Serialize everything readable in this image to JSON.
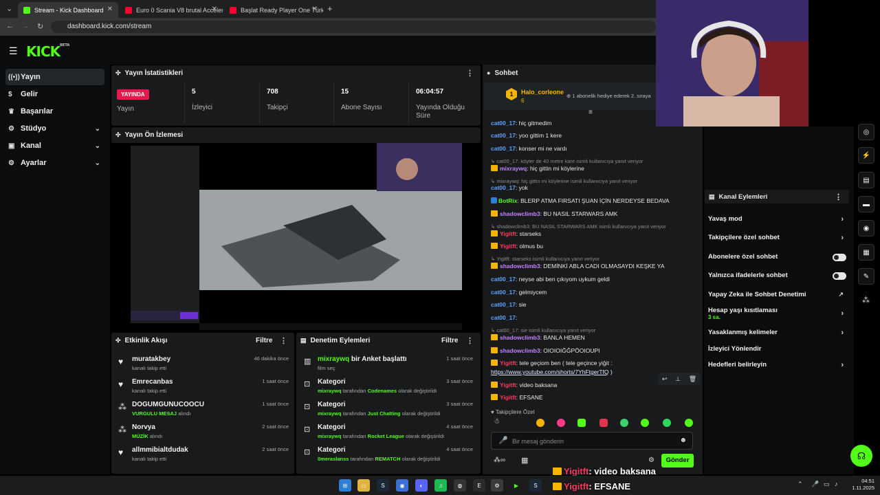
{
  "browser": {
    "tabs": [
      {
        "label": "Stream - Kick Dashboard",
        "color": "#53fc18"
      },
      {
        "label": "Euro 0 Scania V8 brutal Acceler",
        "color": "#ff0033"
      },
      {
        "label": "Başlat Ready Player One Türkçe",
        "color": "#ff0033"
      }
    ],
    "url": "dashboard.kick.com/stream"
  },
  "logo": {
    "text": "KICK",
    "sup": "BETA"
  },
  "sidebar": {
    "items": [
      {
        "label": "Yayın",
        "icon": "broadcast-icon"
      },
      {
        "label": "Gelir",
        "icon": "dollar-icon"
      },
      {
        "label": "Başarılar",
        "icon": "trophy-icon"
      },
      {
        "label": "Stüdyo",
        "icon": "gear-icon"
      },
      {
        "label": "Kanal",
        "icon": "channel-icon"
      },
      {
        "label": "Ayarlar",
        "icon": "settings-icon"
      }
    ]
  },
  "stats": {
    "title": "Yayın İstatistikleri",
    "live_badge": "YAYINDA",
    "cols": [
      {
        "value": "",
        "label": "Yayın"
      },
      {
        "value": "5",
        "label": "İzleyici"
      },
      {
        "value": "708",
        "label": "Takipçi"
      },
      {
        "value": "15",
        "label": "Abone Sayısı"
      },
      {
        "value": "06:04:57",
        "label": "Yayında Olduğu Süre"
      }
    ]
  },
  "preview": {
    "title": "Yayın Ön İzlemesi"
  },
  "activity": {
    "title": "Etkinlik Akışı",
    "filter": "Filtre",
    "rows": [
      {
        "name": "muratakbey",
        "sub": "kanalı takip etti",
        "time": "46 dakika önce"
      },
      {
        "name": "Emrecanbas",
        "sub": "kanalı takip etti",
        "time": "1 saat önce"
      },
      {
        "name": "DOGUMGUNUCOOCU",
        "sub_hl": "VURGULU MESAJ",
        "sub": "alındı",
        "time": "1 saat önce"
      },
      {
        "name": "Norvya",
        "sub_hl": "MÜZİK",
        "sub": "alındı",
        "time": "2 saat önce"
      },
      {
        "name": "allmmibialtdudak",
        "sub": "kanalı takip etti",
        "time": "2 saat önce"
      }
    ]
  },
  "moderation": {
    "title": "Denetim Eylemleri",
    "filter": "Filtre",
    "rows": [
      {
        "user": "mixraywq",
        "title": "bir Anket başlattı",
        "sub": "film seç",
        "time": "1 saat önce"
      },
      {
        "title": "Kategori",
        "user": "mixraywq",
        "mid": "tarafından",
        "cat": "Codenames",
        "end": "olarak değiştirildi",
        "time": "3 saat önce"
      },
      {
        "title": "Kategori",
        "user": "mixraywq",
        "mid": "tarafından",
        "cat": "Just Chatting",
        "end": "olarak değiştirildi",
        "time": "3 saat önce"
      },
      {
        "title": "Kategori",
        "user": "mixraywq",
        "mid": "tarafından",
        "cat": "Rocket League",
        "end": "olarak değiştirildi",
        "time": "4 saat önce"
      },
      {
        "title": "Kategori",
        "user": "0meraslanss",
        "mid": "tarafından",
        "cat": "REMATCH",
        "end": "olarak değiştirildi",
        "time": "4 saat önce"
      }
    ]
  },
  "chat": {
    "title": "Sohbet",
    "pinned_user": "Halo_corleone",
    "pinned_count": "6",
    "pinned_text": "1 abonelik hediye ederek 2. sıraya",
    "messages": [
      {
        "user": "cat00_17",
        "text": ": hiç gitmedim",
        "cls": "u-blue"
      },
      {
        "user": "cat00_17",
        "text": ": yoo gittim 1 kere",
        "cls": "u-blue"
      },
      {
        "user": "cat00_17",
        "text": ": konser mi ne vardı",
        "cls": "u-blue"
      },
      {
        "reply": "cat00_17: köyler de 40 metre kare isimli kullanıcıya yanıt veriyor"
      },
      {
        "user": "mixraywq",
        "text": ": hiç gittin mi köylerine",
        "cls": "u-purple"
      },
      {
        "reply": "mixraywq: hiç gittin mi köylerine isimli kullanıcıya yanıt veriyor"
      },
      {
        "user": "cat00_17",
        "text": ": yok",
        "cls": "u-blue"
      },
      {
        "user": "BotRix",
        "text": ": BLERP ATMA FIRSATI ŞUAN İÇİN NERDEYSE BEDAVA",
        "cls": "u-green"
      },
      {
        "user": "shadowclimb3",
        "text": ": BU NASIL STARWARS AMK",
        "cls": "u-purple"
      },
      {
        "reply": "shadowclimb3: BU NASIL STARWARS AMK isimli kullanıcıya yanıt veriyor"
      },
      {
        "user": "Yigitft",
        "text": ": starseks",
        "cls": "u-red"
      },
      {
        "user": "Yigitft",
        "text": ": olmus bu",
        "cls": "u-red"
      },
      {
        "reply": "Yigitft: starseks isimli kullanıcıya yanıt veriyor"
      },
      {
        "user": "shadowclimb3",
        "text": ": DEMİNKİ ABLA CADI OLMASAYDI KEŞKE YA",
        "cls": "u-purple"
      },
      {
        "user": "cat00_17",
        "text": ": neyse abi ben çıkıyom uykum geldi",
        "cls": "u-blue"
      },
      {
        "user": "cat00_17",
        "text": ": gelmiycem",
        "cls": "u-blue"
      },
      {
        "user": "cat00_17",
        "text": ": sie",
        "cls": "u-blue"
      },
      {
        "user": "cat00_17",
        "text": ":",
        "cls": "u-blue"
      },
      {
        "reply": "cat00_17: sie isimli kullanıcıya yanıt veriyor"
      },
      {
        "user": "shadowclimb3",
        "text": ": BANLA HEMEN",
        "cls": "u-purple"
      },
      {
        "user": "shadowclimb3",
        "text": ": OIOIOIĞĞPÖOIOUPI",
        "cls": "u-purple"
      },
      {
        "user": "Yigitft",
        "text": ": tele geçiom ben ( tele geçince yiğit :",
        "cls": "u-red"
      },
      {
        "link": "https://www.youtube.com/shorts/7YhFtgerTfQ",
        "tail": " )"
      },
      {
        "user": "Yigitft",
        "text": ": video baksana",
        "cls": "u-red"
      },
      {
        "user": "Yigitft",
        "text": ": EFSANE",
        "cls": "u-red"
      }
    ],
    "followers_only": "Takipçilere Özel",
    "input_placeholder": "Bir mesaj gönderin",
    "send_label": "Gönder"
  },
  "channel_actions": {
    "title": "Kanal Eylemleri",
    "items": [
      {
        "label": "Yavaş mod",
        "kind": "chevron"
      },
      {
        "label": "Takipçilere özel sohbet",
        "kind": "chevron"
      },
      {
        "label": "Abonelere özel sohbet",
        "kind": "toggle"
      },
      {
        "label": "Yalnızca ifadelerle sohbet",
        "kind": "toggle"
      },
      {
        "label": "Yapay Zeka ile Sohbet Denetimi",
        "kind": "ext"
      },
      {
        "label": "Hesap yaşı kısıtlaması",
        "sub": "3 sa.",
        "kind": "chevron"
      },
      {
        "label": "Yasaklanmış kelimeler",
        "kind": "chevron"
      },
      {
        "label": "İzleyici Yönlendir",
        "kind": "none"
      },
      {
        "label": "Hedefleri belirleyin",
        "kind": "chevron"
      }
    ]
  },
  "overlay": {
    "line1_user": "Yigitft",
    "line1_text": ": video baksana",
    "line2_user": "Yigitft",
    "line2_text": ": EFSANE"
  },
  "taskbar": {
    "time": "04:51",
    "date": "1.11.2025"
  }
}
